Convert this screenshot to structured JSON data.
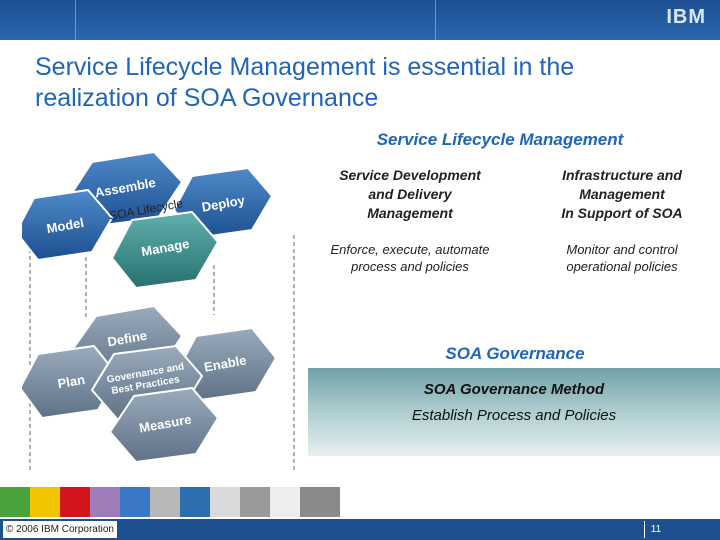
{
  "header": {
    "logo": "IBM"
  },
  "slide": {
    "title": "Service Lifecycle Management is essential in the realization of SOA Governance",
    "slm_heading": "Service Lifecycle Management",
    "panels": [
      {
        "heading_lines": [
          "Service Development",
          "and Delivery",
          "Management"
        ],
        "description_lines": [
          "Enforce, execute, automate",
          "process and policies"
        ]
      },
      {
        "heading_lines": [
          "Infrastructure and",
          "Management",
          "In Support of SOA"
        ],
        "description_lines": [
          "Monitor and control",
          "operational policies"
        ]
      }
    ],
    "governance": {
      "heading": "SOA Governance",
      "method": "SOA Governance Method",
      "policies": "Establish Process and Policies"
    }
  },
  "diagram": {
    "top_hexagons": [
      "Model",
      "Assemble",
      "Deploy",
      "Manage"
    ],
    "lifecycle_label": "SOA Lifecycle",
    "bottom_hexagons": [
      "Plan",
      "Define",
      "Enable",
      "Measure"
    ],
    "center_label_lines": [
      "Governance and",
      "Best Practices"
    ]
  },
  "footer": {
    "copyright": "© 2006 IBM Corporation",
    "page_number": "11"
  },
  "colors": {
    "brand_blue": "#1d4f91",
    "title_blue": "#1f65b8",
    "hex_blue": "#2a67a8",
    "hex_teal": "#3b8f8e",
    "hex_grey": "#7b8d9f"
  }
}
